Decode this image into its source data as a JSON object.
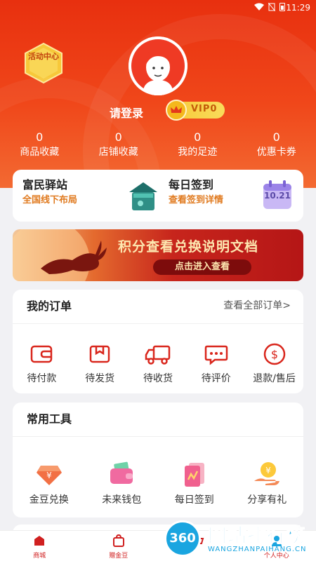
{
  "status_bar": {
    "time": "11:29"
  },
  "header": {
    "activity_badge": "活动中心",
    "login_text": "请登录",
    "vip_label": "VIP0",
    "stats": [
      {
        "count": "0",
        "label": "商品收藏"
      },
      {
        "count": "0",
        "label": "店铺收藏"
      },
      {
        "count": "0",
        "label": "我的足迹"
      },
      {
        "count": "0",
        "label": "优惠卡券"
      }
    ]
  },
  "station_card": {
    "left_title": "富民驿站",
    "left_sub": "全国线下布局",
    "right_title": "每日签到",
    "right_sub": "查看签到详情",
    "calendar_date": "10.21"
  },
  "banner": {
    "title": "积分查看兑换说明文档",
    "button": "点击进入查看"
  },
  "orders": {
    "title": "我的订单",
    "view_all": "查看全部订单>",
    "items": [
      {
        "label": "待付款",
        "icon": "wallet-icon"
      },
      {
        "label": "待发货",
        "icon": "package-icon"
      },
      {
        "label": "待收货",
        "icon": "truck-icon"
      },
      {
        "label": "待评价",
        "icon": "comment-icon"
      },
      {
        "label": "退款/售后",
        "icon": "refund-icon"
      }
    ]
  },
  "tools": {
    "title": "常用工具",
    "items": [
      {
        "label": "金豆兑换",
        "icon": "diamond-yen-icon"
      },
      {
        "label": "未来钱包",
        "icon": "wallet-icon"
      },
      {
        "label": "每日签到",
        "icon": "sign-in-icon"
      },
      {
        "label": "分享有礼",
        "icon": "share-gift-icon"
      }
    ]
  },
  "bottom_nav": [
    {
      "label": "商城",
      "icon": "mall-icon"
    },
    {
      "label": "赠金豆",
      "icon": "bag-icon"
    },
    {
      "label": "",
      "icon": "cart-icon"
    },
    {
      "label": "个人中心",
      "icon": "user-icon"
    }
  ],
  "watermark": {
    "badge": "360",
    "text": "网站排行榜",
    "url": "WANGZHANPAIHANG.CN"
  },
  "colors": {
    "brand_red": "#e8300f",
    "accent_orange": "#e07a1f",
    "text_dark": "#222222"
  }
}
